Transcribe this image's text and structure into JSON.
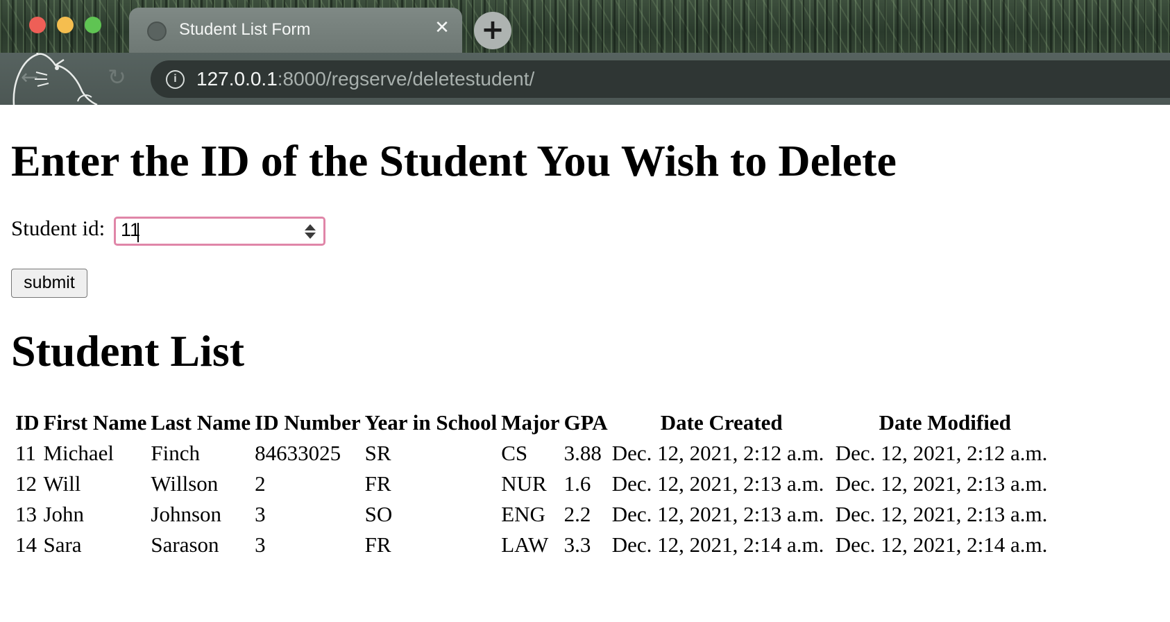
{
  "browser": {
    "tab_title": "Student List Form",
    "close_glyph": "✕",
    "new_tab_glyph": "+",
    "back_glyph": "←",
    "reload_glyph": "↻",
    "info_glyph": "i",
    "url_host": "127.0.0.1",
    "url_rest": ":8000/regserve/deletestudent/",
    "traffic_colors": [
      "#ee5f57",
      "#f5be4f",
      "#5fc453"
    ]
  },
  "form": {
    "heading": "Enter the ID of the Student You Wish to Delete",
    "id_label": "Student id:",
    "id_value": "11",
    "submit_label": "submit"
  },
  "student_list": {
    "heading": "Student List",
    "columns": [
      "ID",
      "First Name",
      "Last Name",
      "ID Number",
      "Year in School",
      "Major",
      "GPA",
      "Date Created",
      "Date Modified"
    ],
    "rows": [
      [
        "11",
        "Michael",
        "Finch",
        "84633025",
        "SR",
        "CS",
        "3.88",
        "Dec. 12, 2021, 2:12 a.m.",
        "Dec. 12, 2021, 2:12 a.m."
      ],
      [
        "12",
        "Will",
        "Willson",
        "2",
        "FR",
        "NUR",
        "1.6",
        "Dec. 12, 2021, 2:13 a.m.",
        "Dec. 12, 2021, 2:13 a.m."
      ],
      [
        "13",
        "John",
        "Johnson",
        "3",
        "SO",
        "ENG",
        "2.2",
        "Dec. 12, 2021, 2:13 a.m.",
        "Dec. 12, 2021, 2:13 a.m."
      ],
      [
        "14",
        "Sara",
        "Sarason",
        "3",
        "FR",
        "LAW",
        "3.3",
        "Dec. 12, 2021, 2:14 a.m.",
        "Dec. 12, 2021, 2:14 a.m."
      ]
    ]
  }
}
